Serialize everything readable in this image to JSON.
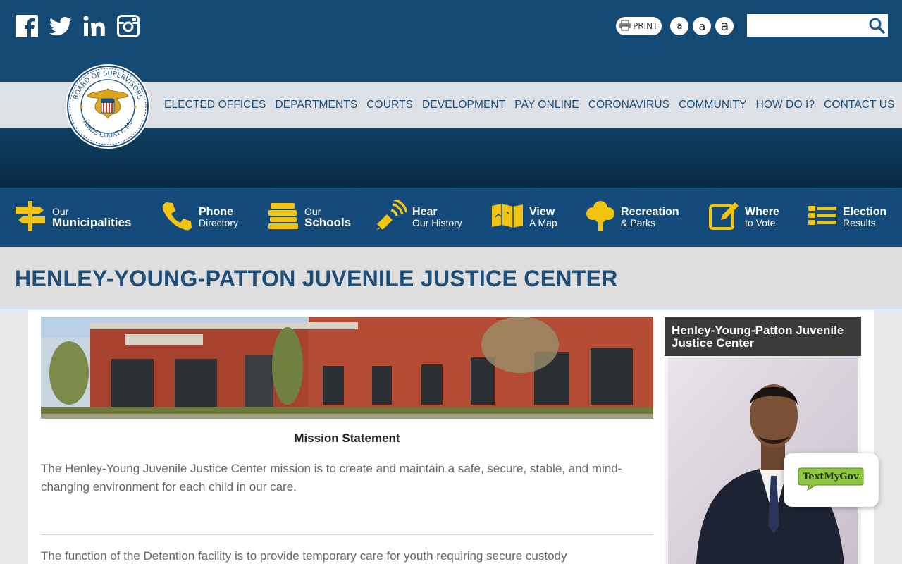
{
  "header": {
    "social": [
      "facebook-icon",
      "twitter-icon",
      "linkedin-icon",
      "instagram-icon"
    ],
    "print_label": "PRINT",
    "font_sizes": [
      "a",
      "a",
      "a"
    ],
    "search_placeholder": "",
    "seal_text": "BOARD OF SUPERVISORS · HINDS COUNTY, MS"
  },
  "nav": {
    "items": [
      "Elected Offices",
      "Departments",
      "Courts",
      "Development",
      "Pay Online",
      "Coronavirus",
      "Community",
      "How Do I?",
      "Contact Us"
    ]
  },
  "quick_links": [
    {
      "top": "Our",
      "bottom": "Municipalities",
      "icon": "signpost-icon"
    },
    {
      "top": "Phone",
      "bottom": "Directory",
      "icon": "phone-icon"
    },
    {
      "top": "Our",
      "bottom": "Schools",
      "icon": "books-icon"
    },
    {
      "top": "Hear",
      "bottom": "Our History",
      "icon": "megaphone-icon"
    },
    {
      "top": "View",
      "bottom": "A Map",
      "icon": "map-icon"
    },
    {
      "top": "Recreation",
      "bottom": "& Parks",
      "icon": "tree-icon"
    },
    {
      "top": "Where",
      "bottom": "to Vote",
      "icon": "edit-icon"
    },
    {
      "top": "Election",
      "bottom": "Results",
      "icon": "list-icon"
    }
  ],
  "page": {
    "title": "HENLEY-YOUNG-PATTON JUVENILE JUSTICE CENTER",
    "mission_heading": "Mission Statement",
    "mission_text": "The Henley-Young Juvenile Justice Center mission is to create and maintain a safe, secure, stable, and mind-changing environment for each child in our care.",
    "function_text": "The function of the Detention facility is to provide temporary care for youth requiring secure custody",
    "sidebar_title": "Henley-Young-Patton Juvenile Justice Center"
  },
  "widget": {
    "label": "TextMyGov"
  },
  "colors": {
    "primary": "#154b7a",
    "accent": "#f2c40f",
    "nav_text": "#1d4f7c",
    "navband": "#dde1e6"
  }
}
